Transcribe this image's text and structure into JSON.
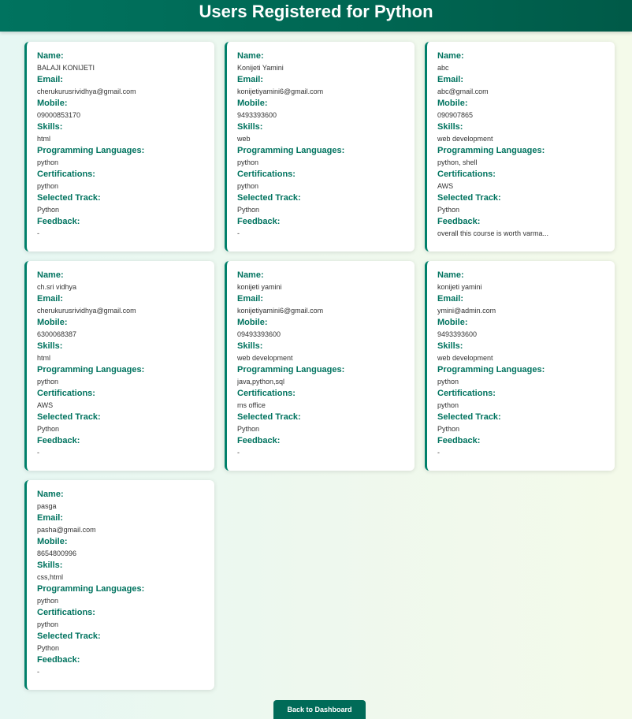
{
  "header": {
    "title": "Users Registered for Python"
  },
  "labels": {
    "name": "Name:",
    "email": "Email:",
    "mobile": "Mobile:",
    "skills": "Skills:",
    "languages": "Programming Languages:",
    "certifications": "Certifications:",
    "track": "Selected Track:",
    "feedback": "Feedback:"
  },
  "users": [
    {
      "name": "BALAJI KONIJETI",
      "email": "cherukurusrividhya@gmail.com",
      "mobile": "09000853170",
      "skills": "html",
      "languages": "python",
      "certifications": "python",
      "track": "Python",
      "feedback": "-"
    },
    {
      "name": "Konijeti Yamini",
      "email": "konijetiyamini6@gmail.com",
      "mobile": "9493393600",
      "skills": "web",
      "languages": "python",
      "certifications": "python",
      "track": "Python",
      "feedback": "-"
    },
    {
      "name": "abc",
      "email": "abc@gmail.com",
      "mobile": "090907865",
      "skills": "web development",
      "languages": "python, shell",
      "certifications": "AWS",
      "track": "Python",
      "feedback": "overall this course is worth varma..."
    },
    {
      "name": "ch.sri vidhya",
      "email": "cherukurusrividhya@gmail.com",
      "mobile": "6300068387",
      "skills": "html",
      "languages": "python",
      "certifications": "AWS",
      "track": "Python",
      "feedback": "-"
    },
    {
      "name": "konijeti yamini",
      "email": "konijetiyamini6@gmail.com",
      "mobile": "09493393600",
      "skills": "web development",
      "languages": "java,python,sql",
      "certifications": "ms office",
      "track": "Python",
      "feedback": "-"
    },
    {
      "name": "konijeti yamini",
      "email": "ymini@admin.com",
      "mobile": "9493393600",
      "skills": "web development",
      "languages": "python",
      "certifications": "python",
      "track": "Python",
      "feedback": "-"
    },
    {
      "name": "pasga",
      "email": "pasha@gmail.com",
      "mobile": "8654800996",
      "skills": "css,html",
      "languages": "python",
      "certifications": "python",
      "track": "Python",
      "feedback": "-"
    }
  ],
  "footer": {
    "back_label": "Back to Dashboard"
  },
  "colors": {
    "accent": "#00735f",
    "header_bg": "#006652",
    "button_bg": "#006b58"
  }
}
